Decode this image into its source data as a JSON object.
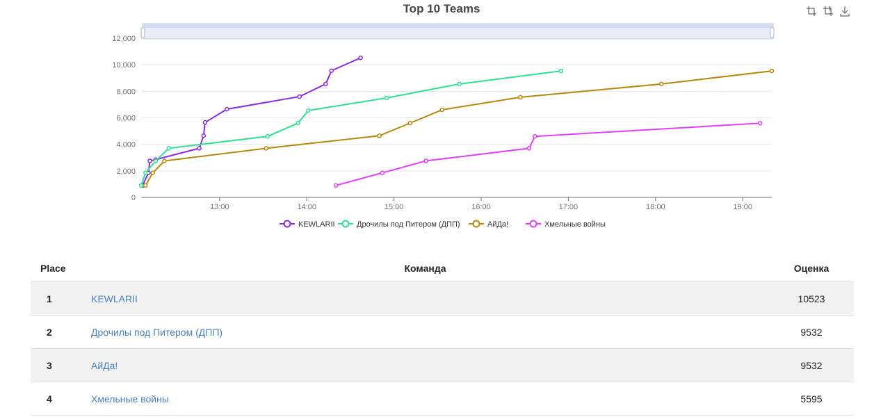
{
  "chart_data": {
    "type": "line",
    "title": "Top 10 Teams",
    "xlabel": "",
    "ylabel": "",
    "x_unit": "time (HH:MM)",
    "xlim": [
      "12:06",
      "19:20"
    ],
    "ylim": [
      0,
      12000
    ],
    "x_ticks": [
      "13:00",
      "14:00",
      "15:00",
      "16:00",
      "17:00",
      "18:00",
      "19:00"
    ],
    "y_ticks": [
      "0",
      "2,000",
      "4,000",
      "6,000",
      "8,000",
      "10,000",
      "12,000"
    ],
    "grid": true,
    "legend": "bottom",
    "series": [
      {
        "name": "KEWLARII",
        "color": "#8a2be2",
        "x": [
          "12:07",
          "12:11",
          "12:12",
          "12:16",
          "12:46",
          "12:49",
          "12:50",
          "13:05",
          "13:55",
          "14:13",
          "14:17",
          "14:37"
        ],
        "y": [
          900,
          1850,
          2750,
          2850,
          3700,
          4650,
          5650,
          6650,
          7600,
          8550,
          9550,
          10523
        ]
      },
      {
        "name": "Дрочилы под Питером (ДПП)",
        "color": "#2ee08f",
        "x": [
          "12:06",
          "12:09",
          "12:16",
          "12:25",
          "13:33",
          "13:54",
          "14:01",
          "14:55",
          "15:45",
          "16:55"
        ],
        "y": [
          900,
          1850,
          2750,
          3700,
          4600,
          5600,
          6550,
          7500,
          8550,
          9532
        ]
      },
      {
        "name": "АйДа!",
        "color": "#b8860b",
        "x": [
          "12:09",
          "12:14",
          "12:22",
          "13:32",
          "14:50",
          "15:11",
          "15:33",
          "16:27",
          "18:04",
          "19:20"
        ],
        "y": [
          900,
          1850,
          2750,
          3700,
          4650,
          5600,
          6600,
          7550,
          8550,
          9532
        ]
      },
      {
        "name": "Хмельные войны",
        "color": "#e040fb",
        "x": [
          "14:20",
          "14:52",
          "15:22",
          "16:33",
          "16:37",
          "19:12"
        ],
        "y": [
          900,
          1850,
          2750,
          3700,
          4600,
          5595
        ]
      }
    ]
  },
  "table": {
    "headers": {
      "place": "Place",
      "team": "Команда",
      "score": "Оценка"
    },
    "rows": [
      {
        "place": "1",
        "team": "KEWLARII",
        "score": "10523"
      },
      {
        "place": "2",
        "team": "Дрочилы под Питером (ДПП)",
        "score": "9532"
      },
      {
        "place": "3",
        "team": "АйДа!",
        "score": "9532"
      },
      {
        "place": "4",
        "team": "Хмельные войны",
        "score": "5595"
      }
    ]
  },
  "toolbox": {
    "icons": [
      "zoom-select-icon",
      "zoom-reset-icon",
      "download-icon"
    ]
  }
}
